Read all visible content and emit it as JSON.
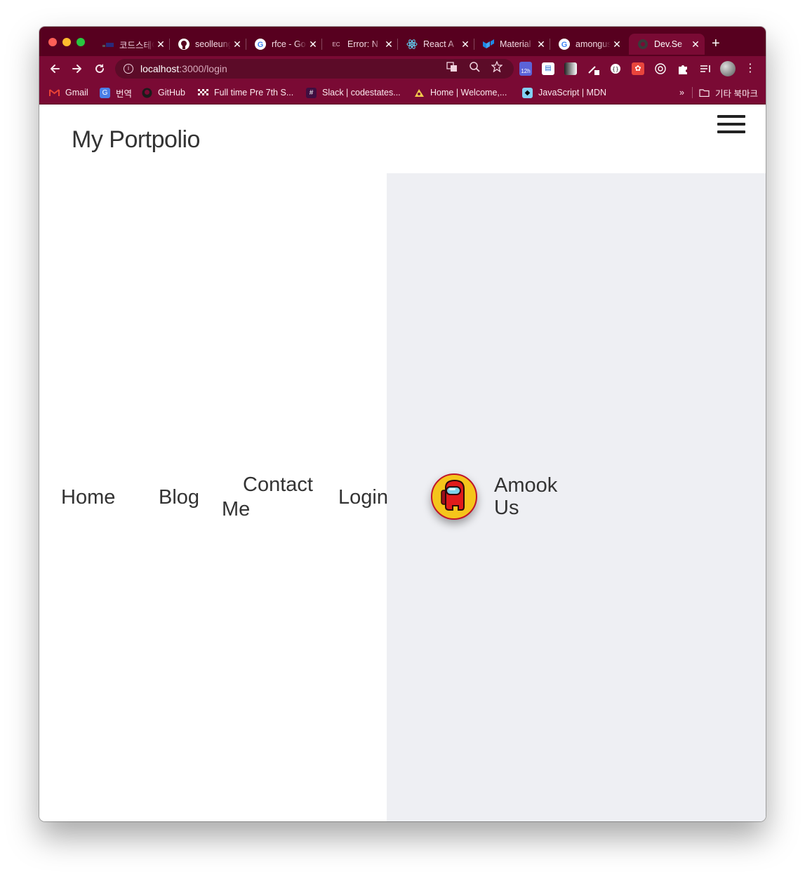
{
  "browser": {
    "tabs": [
      {
        "title": "코드스테이츠",
        "favicon": "codestates-icon"
      },
      {
        "title": "seolleung",
        "favicon": "github-icon"
      },
      {
        "title": "rfce - Google",
        "favicon": "google-icon"
      },
      {
        "title": "Error: N",
        "favicon": "error-page-icon",
        "favicon_text": "EC"
      },
      {
        "title": "React A",
        "favicon": "react-icon"
      },
      {
        "title": "Material",
        "favicon": "material-ui-icon"
      },
      {
        "title": "amongus",
        "favicon": "google-icon"
      },
      {
        "title": "Dev.Se",
        "favicon": "devsec-icon",
        "active": true
      }
    ],
    "close_glyph": "✕",
    "new_tab_glyph": "+",
    "address": {
      "host": "localhost",
      "path": ":3000/login"
    },
    "extension_badge": "12h",
    "bookmarks": [
      {
        "label": "Gmail",
        "icon": "gmail-icon"
      },
      {
        "label": "번역",
        "icon": "translate-icon"
      },
      {
        "label": "GitHub",
        "icon": "github-icon"
      },
      {
        "label": "Full time Pre 7th S...",
        "icon": "checkered-icon"
      },
      {
        "label": "Slack | codestates...",
        "icon": "slack-icon"
      },
      {
        "label": "Home | Welcome,...",
        "icon": "folder-user-icon"
      },
      {
        "label": "JavaScript | MDN",
        "icon": "mdn-icon"
      }
    ],
    "bookmarks_overflow": "»",
    "other_bookmarks": "기타 북마크",
    "colors": {
      "frame": "#57001f",
      "toolbar": "#7a0a34"
    }
  },
  "page": {
    "logo": "My Portpolio",
    "nav": {
      "home": "Home",
      "blog": "Blog",
      "contact_line1": "Contact",
      "contact_line2": "Me",
      "login": "Login"
    },
    "brand_line1": "Amook",
    "brand_line2": "Us",
    "panel_color": "#eeeff3"
  }
}
